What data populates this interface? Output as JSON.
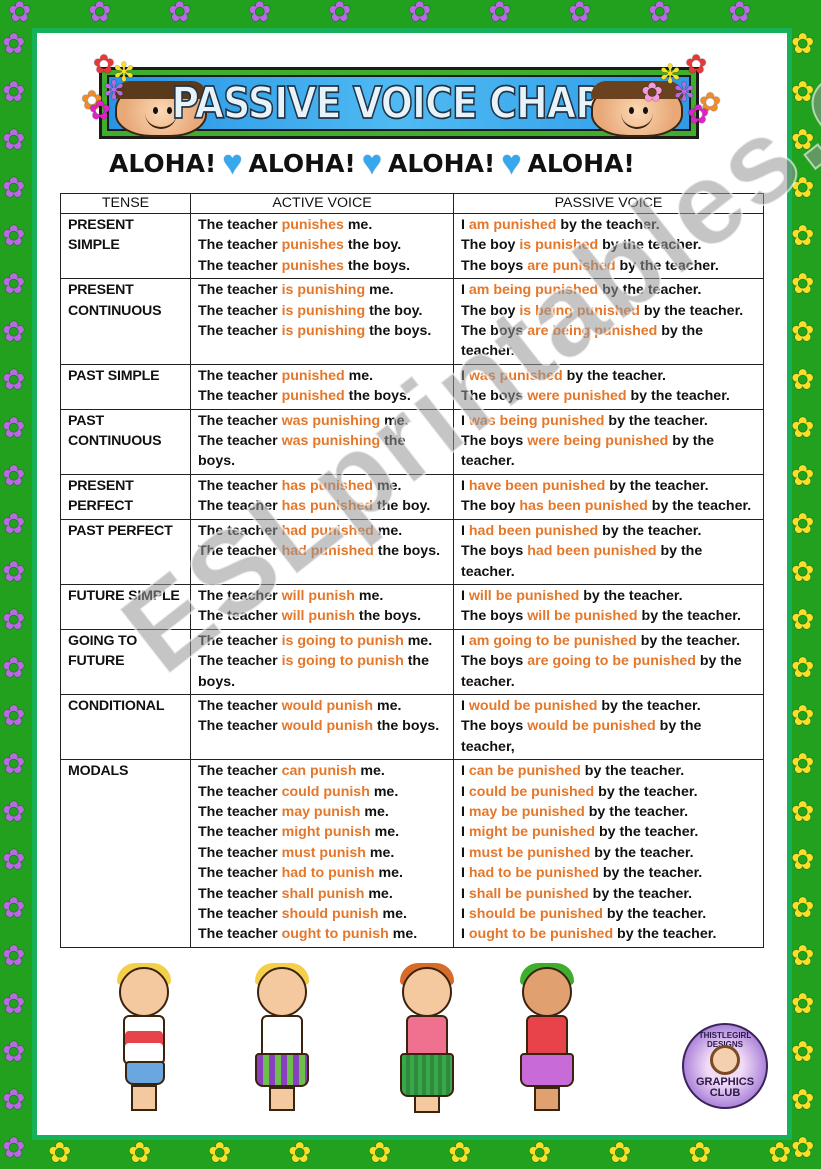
{
  "header": {
    "title": "PASSIVE VOICE CHART",
    "aloha_words": [
      "ALOHA!",
      "ALOHA!",
      "ALOHA!",
      "ALOHA!"
    ],
    "separator_icon": "heart-icon"
  },
  "colors": {
    "border_green": "#22a11f",
    "frame_green": "#16b158",
    "highlight_orange": "#e4772a",
    "banner_blue": "#2f9be8",
    "text": "#111111"
  },
  "table": {
    "headers": [
      "TENSE",
      "ACTIVE VOICE",
      "PASSIVE VOICE"
    ],
    "rows": [
      {
        "tense": "PRESENT SIMPLE",
        "active": [
          {
            "pre": "The teacher ",
            "hl": "punishes",
            "post": " me."
          },
          {
            "pre": "The teacher ",
            "hl": "punishes",
            "post": " the boy."
          },
          {
            "pre": "The teacher ",
            "hl": "punishes",
            "post": " the boys."
          }
        ],
        "passive": [
          {
            "pre": "I ",
            "hl": "am punished",
            "post": " by the teacher."
          },
          {
            "pre": "The boy ",
            "hl": "is punished",
            "post": " by the teacher."
          },
          {
            "pre": "The boys ",
            "hl": "are punished",
            "post": " by the teacher."
          }
        ]
      },
      {
        "tense": "PRESENT CONTINUOUS",
        "active": [
          {
            "pre": "The teacher ",
            "hl": "is punishing",
            "post": " me."
          },
          {
            "pre": "The teacher ",
            "hl": "is punishing",
            "post": " the boy."
          },
          {
            "pre": "The teacher ",
            "hl": "is punishing",
            "post": " the boys."
          }
        ],
        "passive": [
          {
            "pre": "I ",
            "hl": "am being punished",
            "post": " by the teacher."
          },
          {
            "pre": "The boy ",
            "hl": "is being punished",
            "post": " by the teacher."
          },
          {
            "pre": "The boys ",
            "hl": "are being punished",
            "post": " by the teacher."
          }
        ]
      },
      {
        "tense": "PAST SIMPLE",
        "active": [
          {
            "pre": "The teacher ",
            "hl": "punished",
            "post": " me."
          },
          {
            "pre": "The teacher ",
            "hl": "punished",
            "post": " the boys."
          }
        ],
        "passive": [
          {
            "pre": "I ",
            "hl": "was punished",
            "post": " by the teacher."
          },
          {
            "pre": "The boys ",
            "hl": "were punished",
            "post": " by the teacher."
          }
        ]
      },
      {
        "tense": "PAST CONTINUOUS",
        "active": [
          {
            "pre": "The teacher ",
            "hl": "was punishing",
            "post": " me."
          },
          {
            "pre": "The teacher ",
            "hl": "was punishing",
            "post": " the boys."
          }
        ],
        "passive": [
          {
            "pre": "I ",
            "hl": "was being punished",
            "post": " by the teacher."
          },
          {
            "pre": "The boys ",
            "hl": "were being punished",
            "post": " by the teacher."
          }
        ]
      },
      {
        "tense": "PRESENT PERFECT",
        "active": [
          {
            "pre": "The teacher ",
            "hl": "has punished",
            "post": " me."
          },
          {
            "pre": "The teacher ",
            "hl": "has punished",
            "post": " the boy."
          }
        ],
        "passive": [
          {
            "pre": "I ",
            "hl": "have been punished",
            "post": " by the teacher."
          },
          {
            "pre": "The boy ",
            "hl": "has been punished",
            "post": " by the teacher."
          }
        ]
      },
      {
        "tense": "PAST PERFECT",
        "active": [
          {
            "pre": "The teacher ",
            "hl": "had punished",
            "post": " me."
          },
          {
            "pre": "The teacher ",
            "hl": "had punished",
            "post": " the boys."
          }
        ],
        "passive": [
          {
            "pre": "I ",
            "hl": "had been punished",
            "post": " by the teacher."
          },
          {
            "pre": "The boys ",
            "hl": "had been punished",
            "post": " by the teacher."
          }
        ]
      },
      {
        "tense": "FUTURE SIMPLE",
        "active": [
          {
            "pre": "The teacher ",
            "hl": "will punish",
            "post": " me."
          },
          {
            "pre": "The teacher ",
            "hl": "will punish",
            "post": " the boys."
          }
        ],
        "passive": [
          {
            "pre": "I ",
            "hl": "will be punished",
            "post": " by the teacher."
          },
          {
            "pre": "The boys ",
            "hl": "will be punished",
            "post": " by the teacher."
          }
        ]
      },
      {
        "tense": "GOING TO FUTURE",
        "active": [
          {
            "pre": "The teacher ",
            "hl": "is going to punish",
            "post": " me."
          },
          {
            "pre": "The teacher ",
            "hl": "is going to punish",
            "post": " the boys."
          }
        ],
        "passive": [
          {
            "pre": "I ",
            "hl": "am going to be punished",
            "post": " by the teacher."
          },
          {
            "pre": "The boys ",
            "hl": "are going to be punished",
            "post": " by the teacher."
          }
        ]
      },
      {
        "tense": "CONDITIONAL",
        "active": [
          {
            "pre": "The teacher ",
            "hl": "would punish",
            "post": " me."
          },
          {
            "pre": "The teacher ",
            "hl": "would punish",
            "post": " the boys."
          }
        ],
        "passive": [
          {
            "pre": "I ",
            "hl": "would be punished",
            "post": " by the teacher."
          },
          {
            "pre": "The boys ",
            "hl": "would be punished",
            "post": " by the teacher,"
          }
        ]
      },
      {
        "tense": "MODALS",
        "active": [
          {
            "pre": "The teacher ",
            "hl": "can punish",
            "post": " me."
          },
          {
            "pre": "The teacher ",
            "hl": "could punish",
            "post": " me."
          },
          {
            "pre": "The teacher ",
            "hl": "may punish",
            "post": " me."
          },
          {
            "pre": "The teacher ",
            "hl": "might punish",
            "post": " me."
          },
          {
            "pre": "The teacher ",
            "hl": "must punish",
            "post": " me."
          },
          {
            "pre": "The teacher ",
            "hl": "had to punish",
            "post": " me."
          },
          {
            "pre": "The teacher ",
            "hl": "shall punish",
            "post": " me."
          },
          {
            "pre": "The teacher ",
            "hl": "should punish",
            "post": " me."
          },
          {
            "pre": "The teacher ",
            "hl": "ought to punish",
            "post": " me."
          }
        ],
        "passive": [
          {
            "pre": "I ",
            "hl": "can be punished",
            "post": " by the teacher."
          },
          {
            "pre": "I ",
            "hl": "could be punished",
            "post": " by the teacher."
          },
          {
            "pre": "I ",
            "hl": "may be punished",
            "post": " by the teacher."
          },
          {
            "pre": "I ",
            "hl": "might be punished",
            "post": " by the teacher."
          },
          {
            "pre": "I ",
            "hl": "must be punished",
            "post": " by the teacher."
          },
          {
            "pre": "I ",
            "hl": "had to be punished",
            "post": " by the teacher."
          },
          {
            "pre": "I ",
            "hl": "shall be punished",
            "post": " by the teacher."
          },
          {
            "pre": "I ",
            "hl": "should be punished",
            "post": " by the teacher."
          },
          {
            "pre": "I ",
            "hl": "ought to be punished",
            "post": " by the teacher."
          }
        ]
      }
    ]
  },
  "watermark": "ESLprintables.com",
  "logo": {
    "top_text": "THISTLEGIRL DESIGNS",
    "bottom_text": "GRAPHICS CLUB"
  },
  "illustrations": [
    "boy-hawaiian-shirt-illustration",
    "girl-coconut-drink-illustration",
    "hula-girl-illustration",
    "boy-ukulele-illustration"
  ]
}
